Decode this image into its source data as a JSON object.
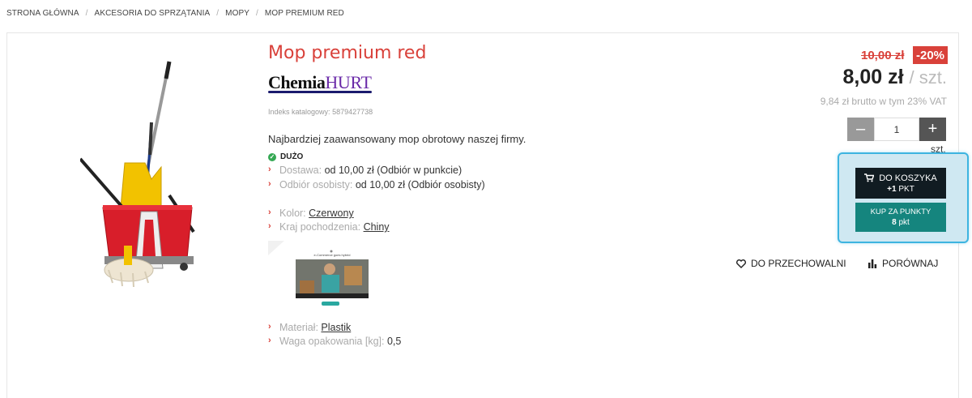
{
  "breadcrumb": {
    "items": [
      "STRONA GŁÓWNA",
      "AKCESORIA DO SPRZĄTANIA",
      "MOPY",
      "MOP PREMIUM RED"
    ],
    "separator": "/"
  },
  "product": {
    "title": "Mop premium red",
    "brand_part1": "Chemia",
    "brand_part2": "HURT",
    "index_label": "Indeks katalogowy:",
    "index_value": "5879427738",
    "description": "Najbardziej zaawansowany mop obrotowy naszej firmy.",
    "stock_label": "DUŻO",
    "attributes": [
      {
        "key": "Dostawa:",
        "value": "od 10,00 zł (Odbiór w punkcie)",
        "link": false
      },
      {
        "key": "Odbiór osobisty:",
        "value": "od 10,00 zł (Odbiór osobisty)",
        "link": false
      },
      {
        "key": "Kolor:",
        "value": "Czerwony",
        "link": true
      },
      {
        "key": "Kraj pochodzenia:",
        "value": "Chiny",
        "link": true
      },
      {
        "key": "Materiał:",
        "value": "Plastik",
        "link": true
      },
      {
        "key": "Waga opakowania [kg]:",
        "value": "0,5",
        "link": false
      }
    ],
    "video": {
      "caption": "e-Commerce goes hybrid"
    }
  },
  "price": {
    "old": "10,00 zł",
    "discount": "-20%",
    "current": "8,00 zł",
    "unit": "/ szt.",
    "brutto": "9,84 zł brutto w tym 23% VAT"
  },
  "quantity": {
    "minus": "–",
    "value": "1",
    "plus": "+",
    "unit": "szt."
  },
  "buttons": {
    "cart_label": "DO KOSZYKA",
    "cart_points_prefix": "+1",
    "cart_points_suffix": "PKT",
    "points_label": "KUP ZA PUNKTY",
    "points_value": "8",
    "points_unit": "pkt",
    "favorites": "DO PRZECHOWALNI",
    "compare": "PORÓWNAJ"
  },
  "colors": {
    "accent": "#d9413a",
    "cart_button": "#111c22",
    "points_button": "#15857e",
    "highlight": "#3db4e0"
  }
}
